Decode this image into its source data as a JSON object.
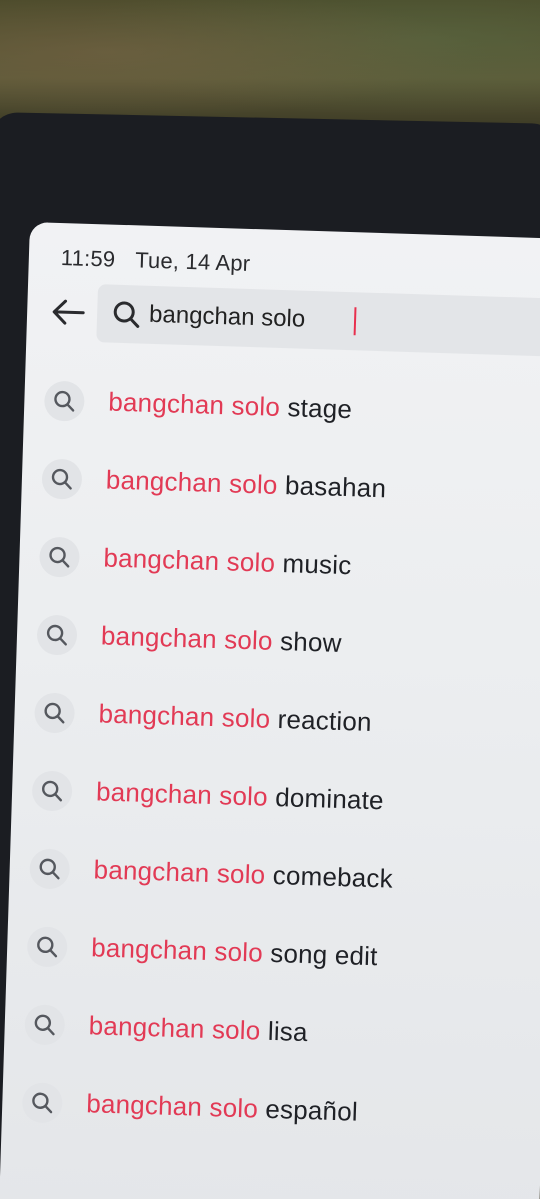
{
  "status": {
    "time": "11:59",
    "date": "Tue, 14 Apr"
  },
  "search": {
    "query": "bangchan solo"
  },
  "colors": {
    "highlight": "#e23a55",
    "text": "#1f2126",
    "background": "#eceef0"
  },
  "icons": {
    "back": "back-arrow-icon",
    "search": "search-icon"
  },
  "suggestions": [
    {
      "match": "bangchan solo",
      "rest": " stage"
    },
    {
      "match": "bangchan solo",
      "rest": " basahan"
    },
    {
      "match": "bangchan solo",
      "rest": " music"
    },
    {
      "match": "bangchan solo",
      "rest": " show"
    },
    {
      "match": "bangchan solo",
      "rest": " reaction"
    },
    {
      "match": "bangchan solo",
      "rest": " dominate"
    },
    {
      "match": "bangchan solo",
      "rest": " comeback"
    },
    {
      "match": "bangchan solo",
      "rest": " song edit"
    },
    {
      "match": "bangchan solo",
      "rest": " lisa"
    },
    {
      "match": "bangchan solo",
      "rest": " español"
    }
  ]
}
